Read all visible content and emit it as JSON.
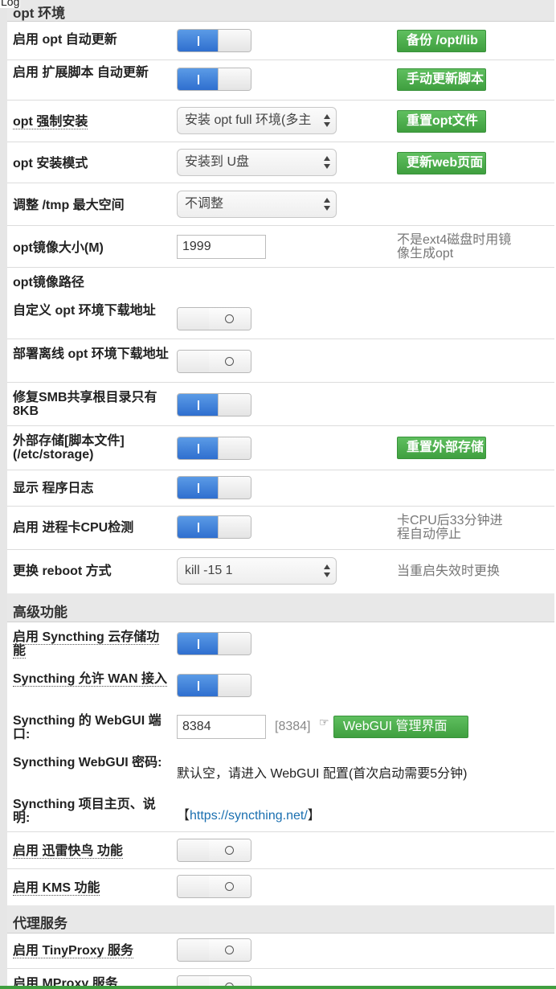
{
  "top_label": "Log",
  "section_opt": "opt 环境",
  "rows": {
    "auto_update": {
      "label": "启用 opt 自动更新",
      "button": "备份 /opt/lib"
    },
    "ext_script": {
      "label": "启用 扩展脚本 自动更新",
      "button": "手动更新脚本"
    },
    "force_install": {
      "label": "opt 强制安装",
      "select": "安装 opt full 环境(多主",
      "button": "重置opt文件"
    },
    "install_mode": {
      "label": "opt 安装模式",
      "select": "安装到 U盘",
      "button": "更新web页面"
    },
    "tmp_size": {
      "label": "调整 /tmp 最大空间",
      "select": "不调整"
    },
    "img_size": {
      "label": "opt镜像大小(M)",
      "value": "1999",
      "note": "不是ext4磁盘时用镜像生成opt"
    },
    "img_path": {
      "label": "opt镜像路径"
    },
    "custom_dl": {
      "label": "自定义 opt 环境下载地址"
    },
    "offline_dl": {
      "label": "部署离线 opt 环境下载地址"
    },
    "smb_fix": {
      "label": "修复SMB共享根目录只有8KB"
    },
    "ext_storage": {
      "label": "外部存储[脚本文件](/etc/storage)",
      "button": "重置外部存储"
    },
    "show_log": {
      "label": "显示 程序日志"
    },
    "cpu_check": {
      "label": "启用 进程卡CPU检测",
      "note": "卡CPU后33分钟进程自动停止"
    },
    "reboot_mode": {
      "label": "更换 reboot 方式",
      "select": "kill -15 1",
      "note": "当重启失效时更换"
    }
  },
  "section_adv": "高级功能",
  "adv": {
    "syncthing": {
      "label": "启用 Syncthing 云存储功能"
    },
    "syncthing_wan": {
      "label": "Syncthing 允许 WAN 接入"
    },
    "syncthing_port": {
      "label": "Syncthing 的 WebGUI 端口:",
      "value": "8384",
      "hint": "[8384]",
      "hand": "☞",
      "button": "WebGUI 管理界面"
    },
    "syncthing_pwd": {
      "label": "Syncthing WebGUI 密码:",
      "text": "默认空，请进入 WebGUI 配置(首次启动需要5分钟)"
    },
    "syncthing_home": {
      "label": "Syncthing 项目主页、说明:",
      "open": "【",
      "link": "https://syncthing.net/",
      "close": "】"
    },
    "xunlei": {
      "label": "启用 迅雷快鸟 功能"
    },
    "kms": {
      "label": "启用 KMS 功能"
    }
  },
  "section_proxy": "代理服务",
  "proxy": {
    "tinyproxy": {
      "label": "启用 TinyProxy 服务"
    },
    "mproxy": {
      "label": "启用 MProxy 服务"
    }
  },
  "toggles": {
    "auto_update": "on",
    "ext_script": "on",
    "custom_dl": "off",
    "offline_dl": "off",
    "smb_fix": "on",
    "ext_storage": "on",
    "show_log": "on",
    "cpu_check": "on",
    "syncthing": "on",
    "syncthing_wan": "on",
    "xunlei": "off",
    "kms": "off",
    "tinyproxy": "off",
    "mproxy": "off"
  },
  "colors": {
    "accent_blue": "#2f6fcf",
    "button_green": "#3f9f3f",
    "link": "#1a6fb0"
  }
}
